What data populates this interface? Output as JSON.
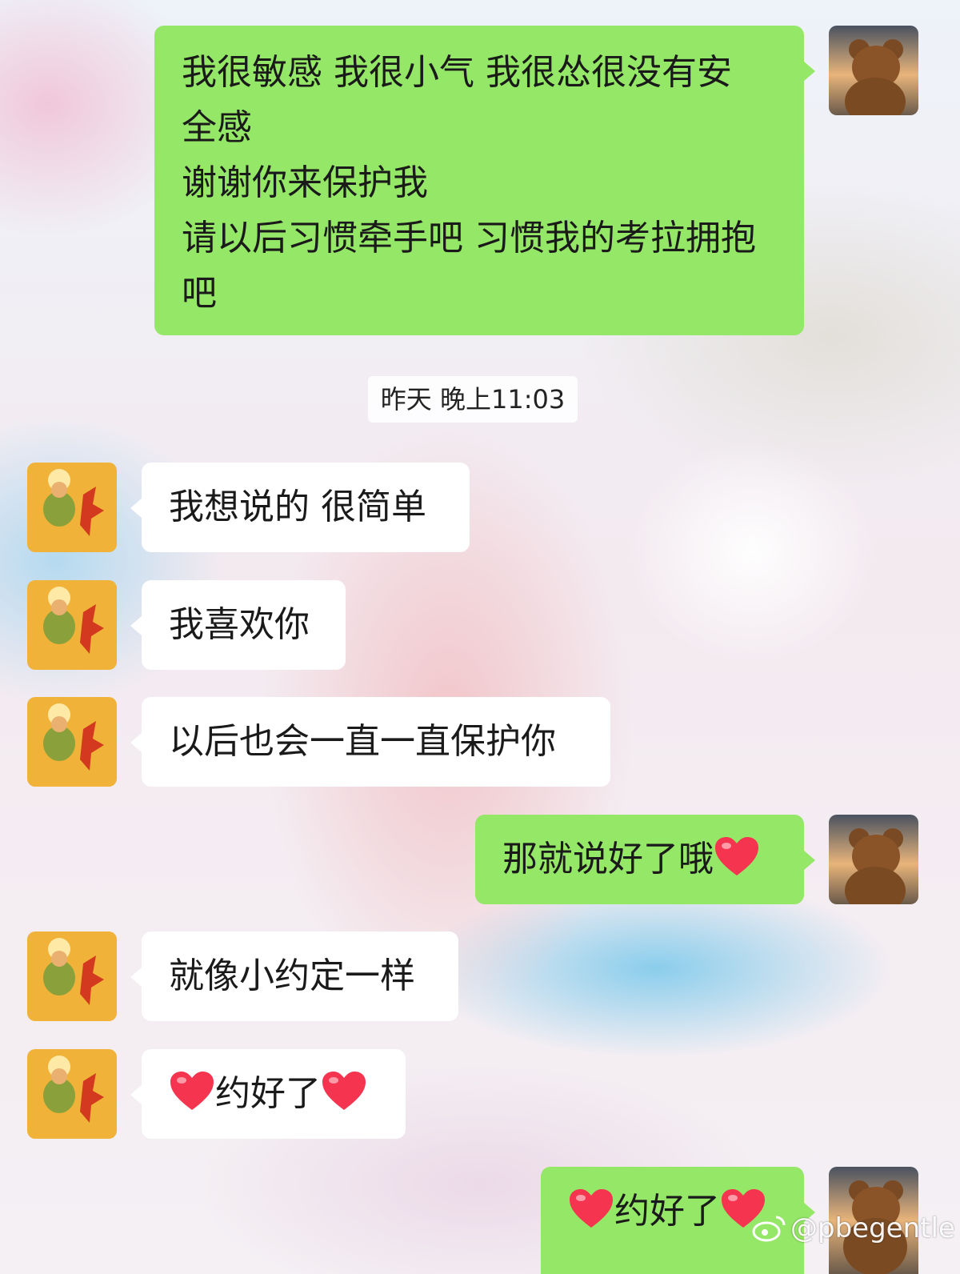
{
  "timestamp": "昨天 晚上11:03",
  "watermark": "@pbegentle",
  "colors": {
    "sent_bubble": "#95e767",
    "received_bubble": "#ffffff",
    "heart": "#f5344f"
  },
  "messages": [
    {
      "sender": "me",
      "lines": [
        "我很敏感 我很小气 我很怂很没有安",
        "全感",
        "谢谢你来保护我",
        "请以后习惯牵手吧 习惯我的考拉拥抱",
        "吧"
      ]
    },
    {
      "sender": "other",
      "text": "我想说的 很简单"
    },
    {
      "sender": "other",
      "text": "我喜欢你"
    },
    {
      "sender": "other",
      "text": "以后也会一直一直保护你"
    },
    {
      "sender": "me",
      "text": "那就说好了哦",
      "emoji_after": "heart"
    },
    {
      "sender": "other",
      "text": "就像小约定一样"
    },
    {
      "sender": "other",
      "text": "约好了",
      "emoji_before": "heart",
      "emoji_after": "heart"
    },
    {
      "sender": "me",
      "text": "约好了",
      "emoji_before": "heart",
      "emoji_after": "heart"
    }
  ]
}
